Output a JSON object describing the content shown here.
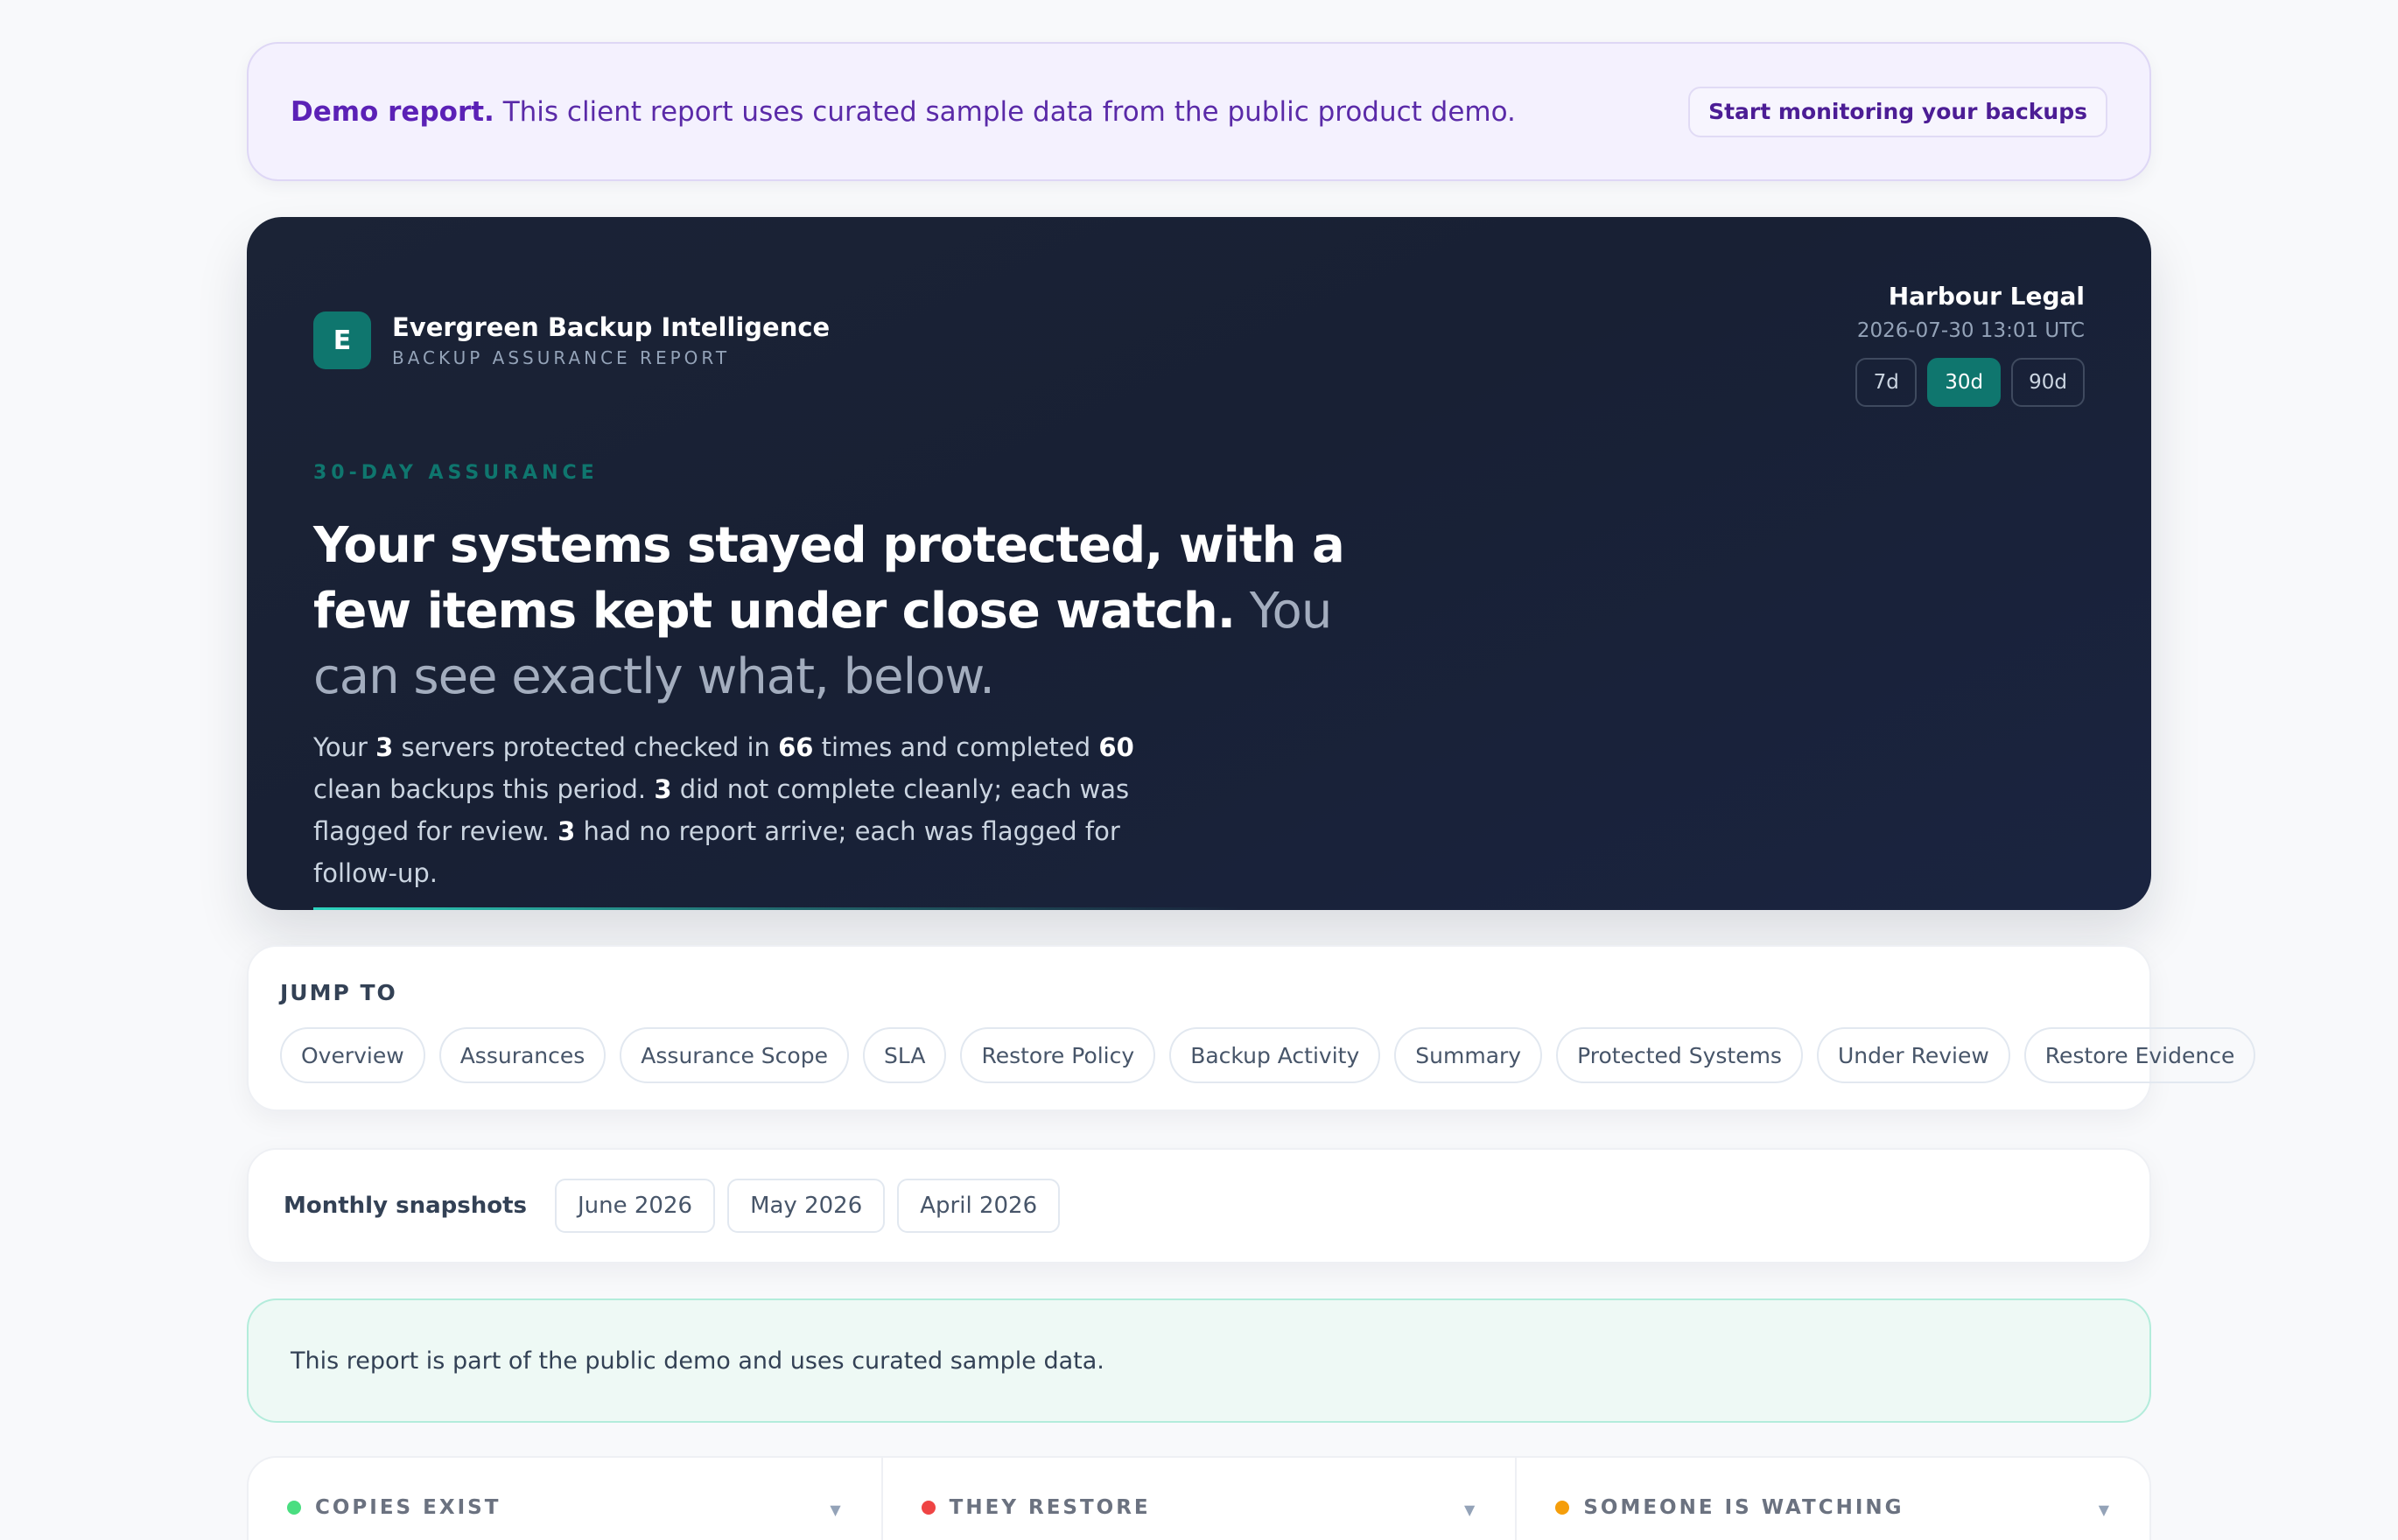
{
  "banner": {
    "strong": "Demo report.",
    "text": " This client report uses curated sample data from the public product demo.",
    "button": "Start monitoring your backups"
  },
  "hero": {
    "brand_initial": "E",
    "brand_name": "Evergreen Backup Intelligence",
    "brand_subtitle": "BACKUP ASSURANCE REPORT",
    "client_name": "Harbour Legal",
    "generated": "2026-07-30 13:01 UTC",
    "ranges": [
      {
        "label": "7d",
        "active": false
      },
      {
        "label": "30d",
        "active": true
      },
      {
        "label": "90d",
        "active": false
      }
    ],
    "eyebrow": "30-DAY ASSURANCE",
    "headline_strong": "Your systems stayed protected, with a few items kept under close watch.",
    "headline_soft": " You can see exactly what, below.",
    "body": {
      "t1": "Your ",
      "servers": "3",
      "t2": " servers protected checked in ",
      "checkins": "66",
      "t3": " times and completed ",
      "clean": "60",
      "t4": " clean backups this period. ",
      "flagged": "3",
      "t5": " did not complete cleanly; each was flagged for review. ",
      "missing": "3",
      "t6": " had no report arrive; each was flagged for follow-up."
    }
  },
  "jump": {
    "title": "JUMP TO",
    "items": [
      "Overview",
      "Assurances",
      "Assurance Scope",
      "SLA",
      "Restore Policy",
      "Backup Activity",
      "Summary",
      "Protected Systems",
      "Under Review",
      "Restore Evidence"
    ]
  },
  "snapshots": {
    "label": "Monthly snapshots",
    "items": [
      "June 2026",
      "May 2026",
      "April 2026"
    ]
  },
  "notice": "This report is part of the public demo and uses curated sample data.",
  "pillars": [
    {
      "label": "COPIES EXIST",
      "color": "#4ade80"
    },
    {
      "label": "THEY RESTORE",
      "color": "#ef4444"
    },
    {
      "label": "SOMEONE IS WATCHING",
      "color": "#f59e0b"
    }
  ]
}
